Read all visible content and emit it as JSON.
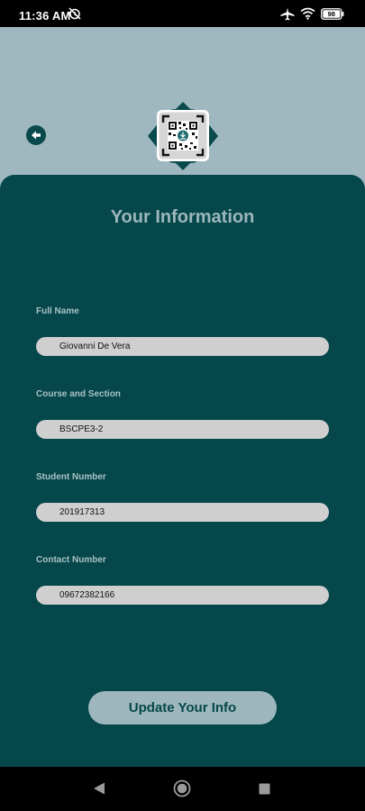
{
  "status_bar": {
    "time": "11:36 AM",
    "battery": "98",
    "icons": [
      "alarm-off-icon",
      "airplane-icon",
      "wifi-icon",
      "battery-icon"
    ]
  },
  "header": {
    "back_icon": "arrow-left-icon",
    "logo_icon": "qr-code-logo-icon"
  },
  "card": {
    "title": "Your Information",
    "fields": [
      {
        "label": "Full Name",
        "value": "Giovanni De Vera"
      },
      {
        "label": "Course and Section",
        "value": "BSCPE3-2"
      },
      {
        "label": "Student Number",
        "value": "201917313"
      },
      {
        "label": "Contact Number",
        "value": "09672382166"
      }
    ],
    "button_label": "Update Your Info"
  },
  "navigation": {
    "icons": [
      "back-triangle-icon",
      "home-circle-icon",
      "recents-square-icon"
    ]
  },
  "colors": {
    "header_bg": "#9fb8bf",
    "card_bg": "#05474a",
    "accent": "#9db7bd",
    "input_bg": "#cfcfcf"
  }
}
